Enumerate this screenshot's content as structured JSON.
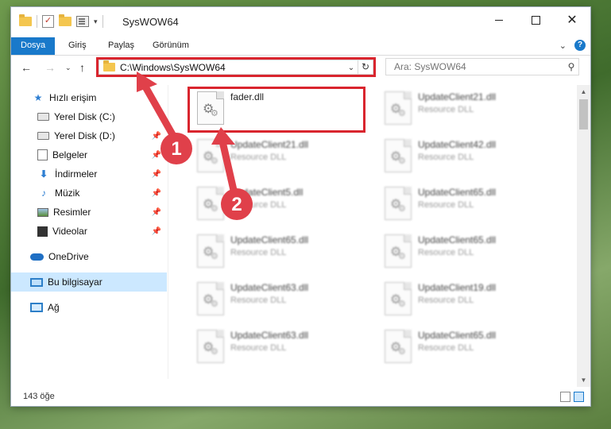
{
  "window": {
    "title": "SysWOW64"
  },
  "ribbon": {
    "tabs": [
      {
        "label": "Dosya"
      },
      {
        "label": "Giriş"
      },
      {
        "label": "Paylaş"
      },
      {
        "label": "Görünüm"
      }
    ]
  },
  "address": {
    "path": "C:\\Windows\\SysWOW64"
  },
  "search": {
    "placeholder": "Ara: SysWOW64"
  },
  "sidebar": {
    "items": [
      {
        "label": "Hızlı erişim"
      },
      {
        "label": "Yerel Disk (C:)"
      },
      {
        "label": "Yerel Disk (D:)"
      },
      {
        "label": "Belgeler"
      },
      {
        "label": "İndirmeler"
      },
      {
        "label": "Müzik"
      },
      {
        "label": "Resimler"
      },
      {
        "label": "Videolar"
      },
      {
        "label": "OneDrive"
      },
      {
        "label": "Bu bilgisayar"
      },
      {
        "label": "Ağ"
      }
    ]
  },
  "files": [
    {
      "name": "fader.dll",
      "type": ""
    },
    {
      "name": "UpdateClient21.dll",
      "type": "Resource DLL"
    },
    {
      "name": "UpdateClient21.dll",
      "type": "Resource DLL"
    },
    {
      "name": "UpdateClient42.dll",
      "type": "Resource DLL"
    },
    {
      "name": "UpdateClient5.dll",
      "type": "Resource DLL"
    },
    {
      "name": "UpdateClient65.dll",
      "type": "Resource DLL"
    },
    {
      "name": "UpdateClient65.dll",
      "type": "Resource DLL"
    },
    {
      "name": "UpdateClient65.dll",
      "type": "Resource DLL"
    },
    {
      "name": "UpdateClient63.dll",
      "type": "Resource DLL"
    },
    {
      "name": "UpdateClient19.dll",
      "type": "Resource DLL"
    },
    {
      "name": "UpdateClient63.dll",
      "type": "Resource DLL"
    },
    {
      "name": "UpdateClient65.dll",
      "type": "Resource DLL"
    }
  ],
  "status": {
    "item_count": "143 öğe"
  },
  "annotations": {
    "step1": "1",
    "step2": "2"
  },
  "colors": {
    "accent": "#1979ca",
    "highlight": "#d9252e"
  }
}
